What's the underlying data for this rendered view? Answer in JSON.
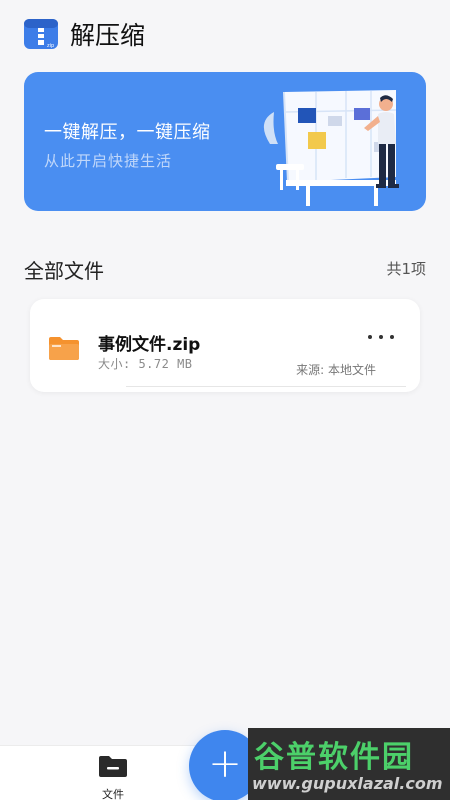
{
  "app": {
    "title": "解压缩",
    "icon": "zip-app-icon"
  },
  "banner": {
    "title": "一键解压，一键压缩",
    "subtitle": "从此开启快捷生活",
    "background": "#4a8ef1"
  },
  "section": {
    "title": "全部文件",
    "count": "共1项"
  },
  "files": [
    {
      "name": "事例文件.zip",
      "size": "大小: 5.72 MB",
      "source": "来源: 本地文件",
      "icon": "folder-icon",
      "icon_color": "#f5922e"
    }
  ],
  "bottom_nav": {
    "files_label": "文件",
    "fab_label": "+"
  },
  "watermark": {
    "title": "谷普软件园",
    "url": "www.gupuxlazal.com"
  },
  "colors": {
    "accent": "#3f86ee",
    "background": "#f6f6f8"
  }
}
